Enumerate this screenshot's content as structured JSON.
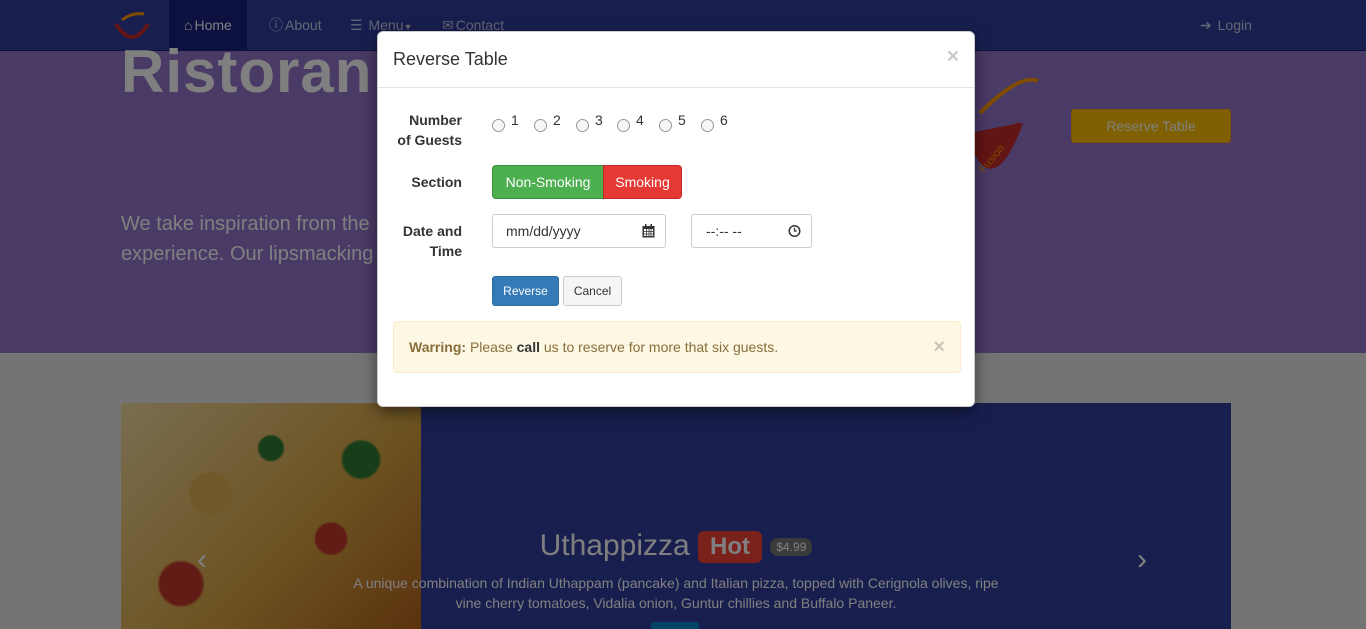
{
  "navbar": {
    "items": [
      {
        "label": "Home",
        "icon": "home-icon"
      },
      {
        "label": "About",
        "icon": "info-icon"
      },
      {
        "label": "Menu",
        "icon": "list-icon"
      },
      {
        "label": "Contact",
        "icon": "envelope-icon"
      }
    ],
    "login_label": "Login"
  },
  "jumbotron": {
    "title": "Ristoran",
    "text_line1": "We take inspiration from the",
    "text_line2": "experience. Our lipsmacking",
    "reserve_label": "Reserve Table",
    "logo_text": "Fusion"
  },
  "carousel": {
    "title": "Uthappizza",
    "badge": "Hot",
    "price": "$4.99",
    "description": "A unique combination of Indian Uthappam (pancake) and Italian pizza, topped with Cerignola olives, ripe vine cherry tomatoes, Vidalia onion, Guntur chillies and Buffalo Paneer."
  },
  "modal": {
    "title": "Reverse Table",
    "close": "×",
    "guests_label_1": "Number",
    "guests_label_2": "of Guests",
    "guest_options": [
      "1",
      "2",
      "3",
      "4",
      "5",
      "6"
    ],
    "section_label": "Section",
    "non_smoking": "Non-Smoking",
    "smoking": "Smoking",
    "datetime_label_1": "Date and",
    "datetime_label_2": "Time",
    "date_placeholder": "mm/dd/yyyy",
    "time_placeholder": "--:-- --",
    "reverse_button": "Reverse",
    "cancel_button": "Cancel",
    "alert": {
      "strong": "Warring:",
      "pre": "Please",
      "call": "call",
      "post": "us to reserve for more that six guests.",
      "close": "×"
    }
  }
}
